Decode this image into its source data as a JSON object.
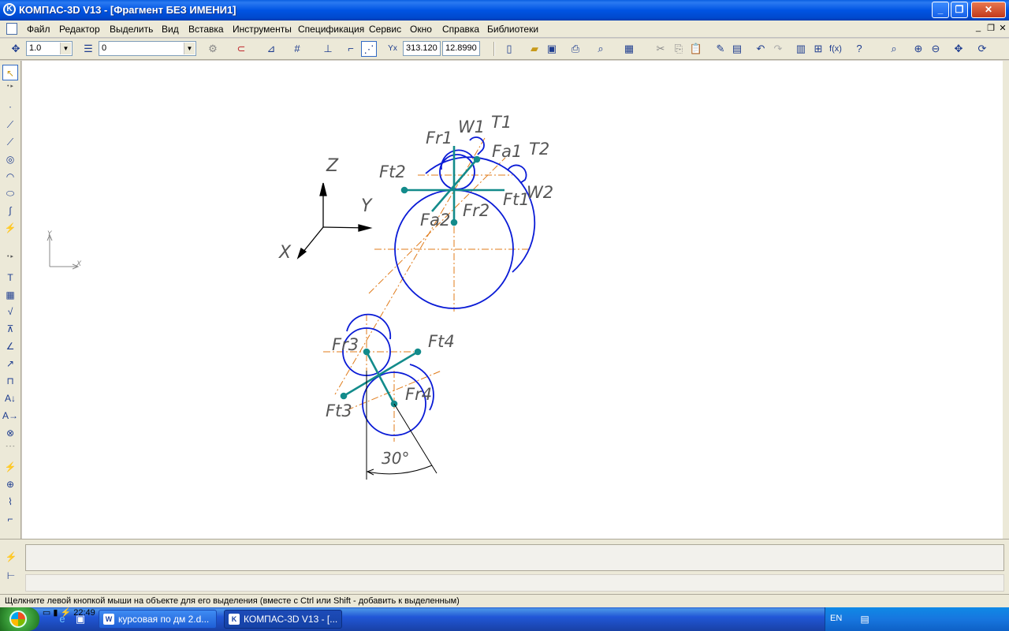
{
  "window": {
    "title": "КОМПАС-3D V13 - [Фрагмент БЕЗ ИМЕНИ1]",
    "app_icon": "K"
  },
  "menu": {
    "items": [
      "Файл",
      "Редактор",
      "Выделить",
      "Вид",
      "Вставка",
      "Инструменты",
      "Спецификация",
      "Сервис",
      "Окно",
      "Справка",
      "Библиотеки"
    ]
  },
  "toolbar": {
    "scale_value": "1.0",
    "layer_value": "0",
    "coord_x": "313.120",
    "coord_y": "12.8990"
  },
  "drawing": {
    "axis_labels": {
      "z": "Z",
      "y": "Y",
      "x": "X"
    },
    "small_axis_labels": {
      "y": "Y",
      "x": "X"
    },
    "force_labels": [
      "Fr1",
      "W1",
      "T1",
      "Fa1",
      "T2",
      "Ft2",
      "Ft1",
      "W2",
      "Fa2",
      "Fr2",
      "Fr3",
      "Ft4",
      "Ft3",
      "Fr4"
    ],
    "angle_label": "30°",
    "colors": {
      "outline": "#0a1bd6",
      "axis": "#e07b1a",
      "force": "#138b8b",
      "annotation": "#555555"
    }
  },
  "status": {
    "hint": "Щелкните левой кнопкой мыши на объекте для его выделения (вместе с Ctrl или Shift - добавить к выделенным)"
  },
  "taskbar": {
    "tasks": [
      {
        "label": "курсовая по дм 2.d...",
        "icon": "W",
        "active": false
      },
      {
        "label": "КОМПАС-3D V13 - [...",
        "icon": "K",
        "active": true
      }
    ],
    "language": "EN",
    "clock": "22:49"
  }
}
